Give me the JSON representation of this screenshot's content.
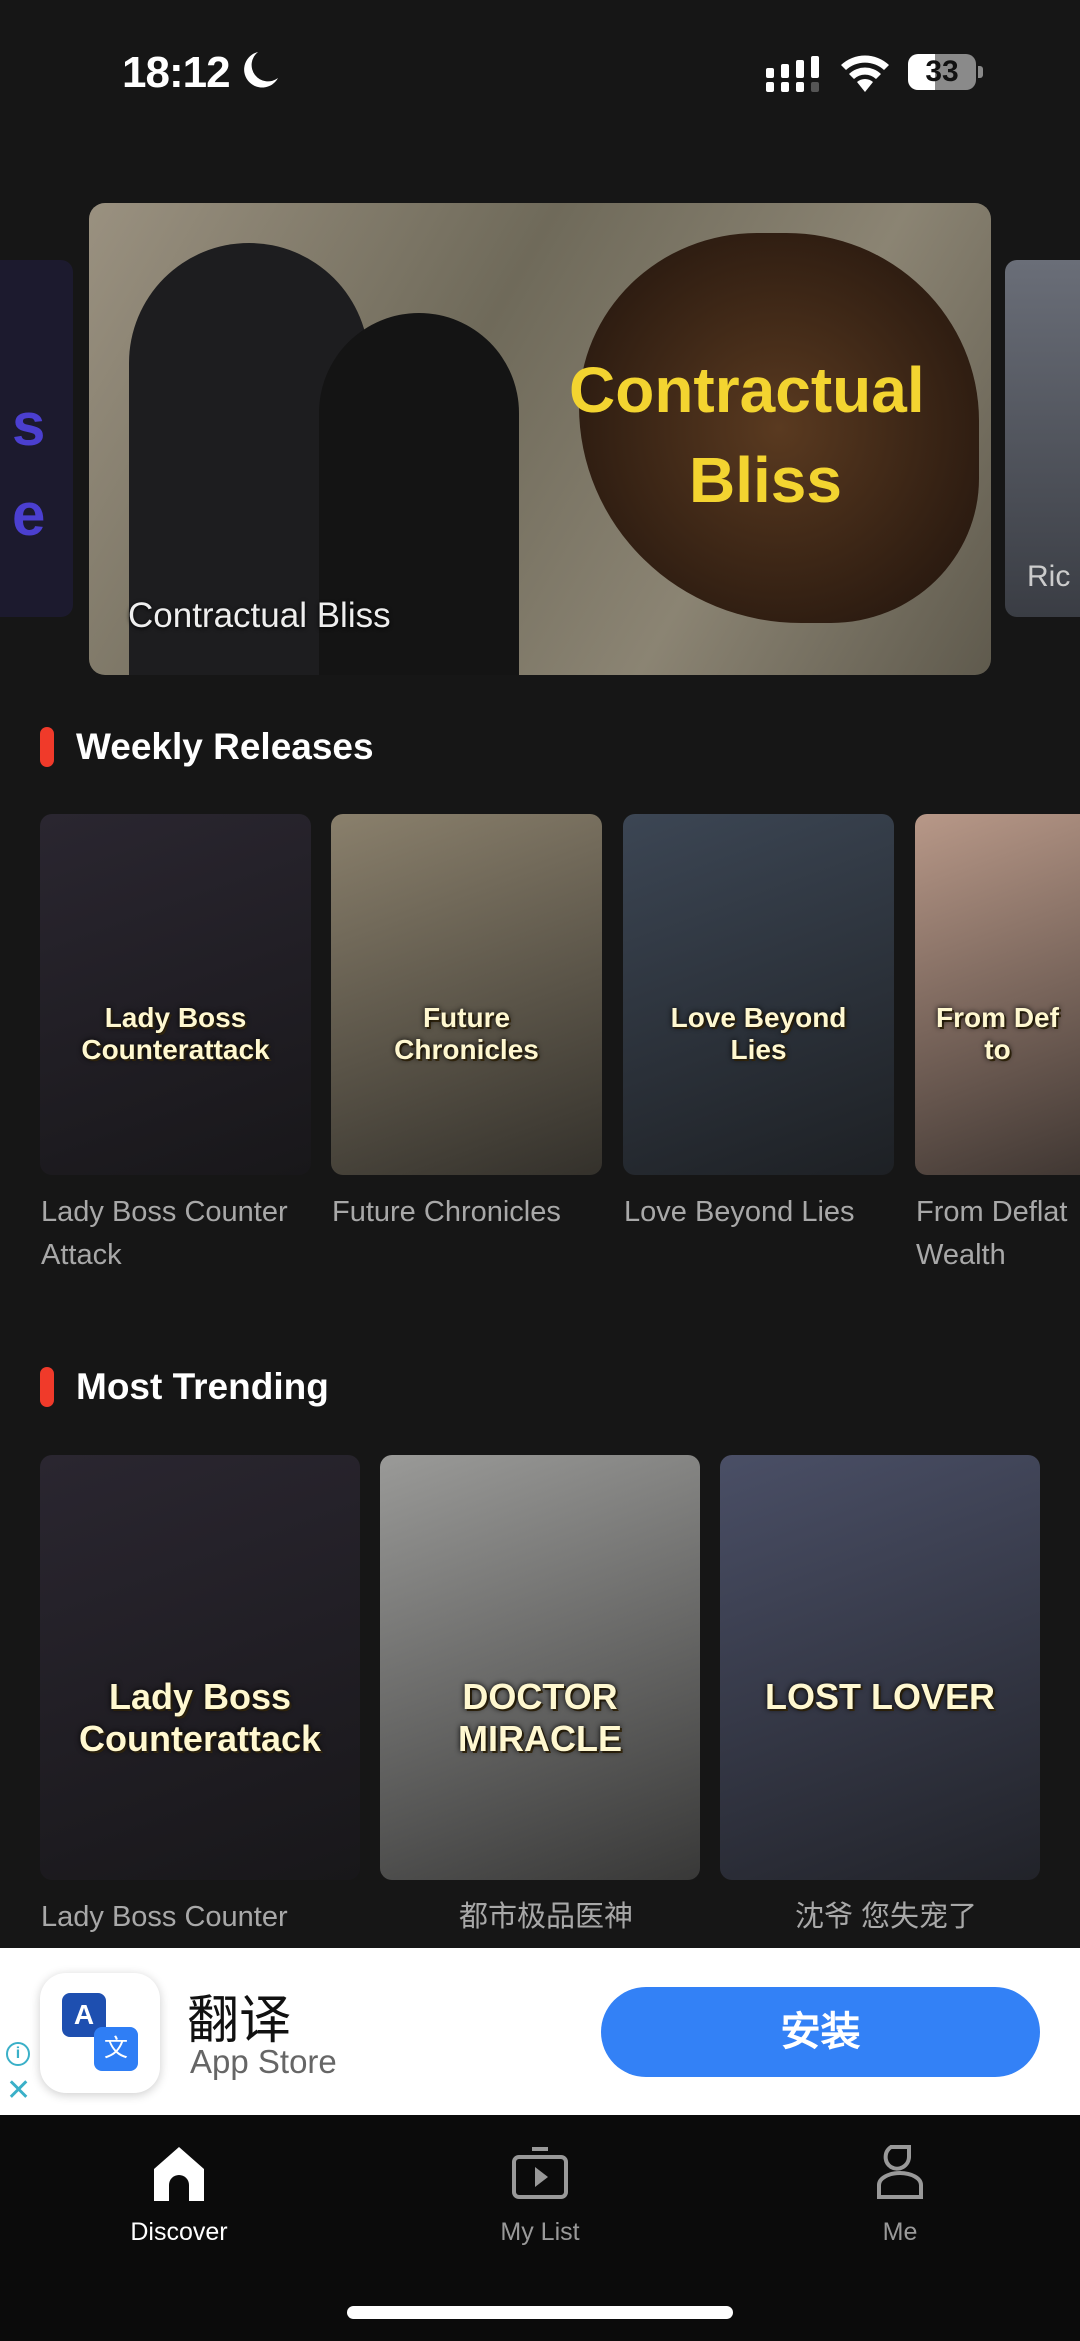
{
  "status_bar": {
    "time": "18:12",
    "battery": "33"
  },
  "banner": {
    "title": "Contractual Bliss",
    "poster_logo_line1": "Contractual",
    "poster_logo_line2": "Bliss",
    "left_peek_text": "s e",
    "right_peek_text": "Ric"
  },
  "weekly": {
    "heading": "Weekly Releases",
    "items": [
      {
        "title": "Lady Boss Counter Attack",
        "poster_text": "Lady Boss Counterattack",
        "color": "#2a2630"
      },
      {
        "title": "Future Chronicles",
        "poster_text": "Future Chronicles",
        "color": "#8a806c"
      },
      {
        "title": "Love Beyond Lies",
        "poster_text": "Love Beyond Lies",
        "color": "#3c4654"
      },
      {
        "title": "From Deflat Wealth",
        "poster_text": "From Def to",
        "color": "#b89888"
      }
    ]
  },
  "trending": {
    "heading": "Most Trending",
    "items": [
      {
        "title": "Lady Boss Counter",
        "poster_text": "Lady Boss Counterattack",
        "color": "#2a2630"
      },
      {
        "title": "都市极品医神",
        "poster_text": "DOCTOR MIRACLE",
        "color": "#9a9a98"
      },
      {
        "title": "沈爷 您失宠了",
        "poster_text": "LOST LOVER",
        "color": "#4a4f66"
      }
    ]
  },
  "ad": {
    "app_name": "翻译",
    "source": "App Store",
    "install_label": "安装",
    "icon_letter_a": "A",
    "icon_letter_b": "文"
  },
  "tabs": [
    {
      "label": "Discover",
      "active": true
    },
    {
      "label": "My List",
      "active": false
    },
    {
      "label": "Me",
      "active": false
    }
  ],
  "colors": {
    "accent": "#f03a2a",
    "install": "#3381f6",
    "background": "#161616"
  }
}
